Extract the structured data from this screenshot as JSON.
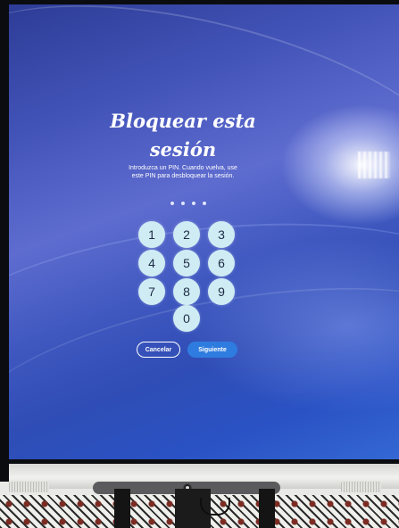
{
  "dialog": {
    "title": "Bloquear esta sesión",
    "description": "Introduzca un PIN. Cuando vuelva, use este PIN para desbloquear la sesión.",
    "pin_length": 4
  },
  "keypad": {
    "keys": [
      "1",
      "2",
      "3",
      "4",
      "5",
      "6",
      "7",
      "8",
      "9",
      "0"
    ]
  },
  "buttons": {
    "cancel_label": "Cancelar",
    "next_label": "Siguiente"
  },
  "colors": {
    "primary_button": "#2f7ce0",
    "key_fill": "#cfecf4",
    "background": "#3f58c0"
  }
}
